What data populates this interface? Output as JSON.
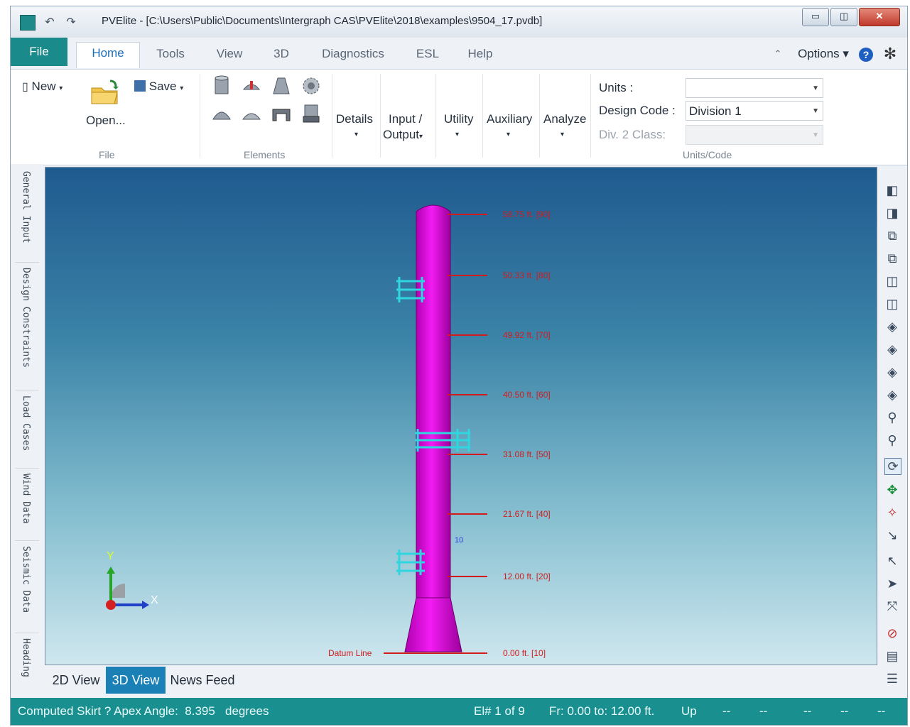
{
  "window": {
    "title": "PVElite - [C:\\Users\\Public\\Documents\\Intergraph CAS\\PVElite\\2018\\examples\\9504_17.pvdb]",
    "undo_icon": "undo-icon",
    "redo_icon": "redo-icon",
    "minimize_label": "▭",
    "restore_label": "◫",
    "close_label": "✕"
  },
  "tabs": {
    "file": "File",
    "items": [
      "Home",
      "Tools",
      "View",
      "3D",
      "Diagnostics",
      "ESL",
      "Help"
    ],
    "options": "Options"
  },
  "ribbon": {
    "new_label": "New",
    "open_label": "Open...",
    "save_label": "Save",
    "file_group": "File",
    "elements_group": "Elements",
    "details_label": "Details",
    "input_output_line1": "Input /",
    "input_output_line2": "Output",
    "utility_label": "Utility",
    "auxiliary_label": "Auxiliary",
    "analyze_label": "Analyze",
    "units_label": "Units :",
    "units_value": "",
    "design_code_label": "Design Code :",
    "design_code_value": "Division 1",
    "div2_label": "Div. 2 Class:",
    "div2_value": "",
    "units_code_group": "Units/Code"
  },
  "left_tabs": [
    "General Input",
    "Design Constraints",
    "Load Cases",
    "Wind Data",
    "Seismic Data",
    "Heading"
  ],
  "viewport": {
    "colors": {
      "vessel": "#e000e0",
      "nozzle": "#2fd6e0",
      "level": "#d21c1c"
    },
    "levels": [
      {
        "text": "58.75 ft.  [90]"
      },
      {
        "text": "50.33 ft.  [80]"
      },
      {
        "text": "49.92 ft.  [70]"
      },
      {
        "text": "40.50 ft.  [60]"
      },
      {
        "text": "31.08 ft.  [50]"
      },
      {
        "text": "21.67 ft.  [40]"
      },
      {
        "text": "12.00 ft.  [20]"
      },
      {
        "text": "0.00 ft.  [10]"
      }
    ],
    "datum_label": "Datum Line",
    "axis_y": "Y",
    "axis_x": "X",
    "small_mark": "10"
  },
  "bottom_tabs": [
    "2D View",
    "3D View",
    "News Feed"
  ],
  "status": {
    "message": "Computed Skirt ? Apex Angle:  8.395   degrees",
    "element": "El# 1 of 9",
    "range": "Fr: 0.00 to: 12.00 ft.",
    "direction": "Up",
    "dash1": "--",
    "dash2": "--",
    "dash3": "--",
    "dash4": "--",
    "dash5": "--"
  }
}
